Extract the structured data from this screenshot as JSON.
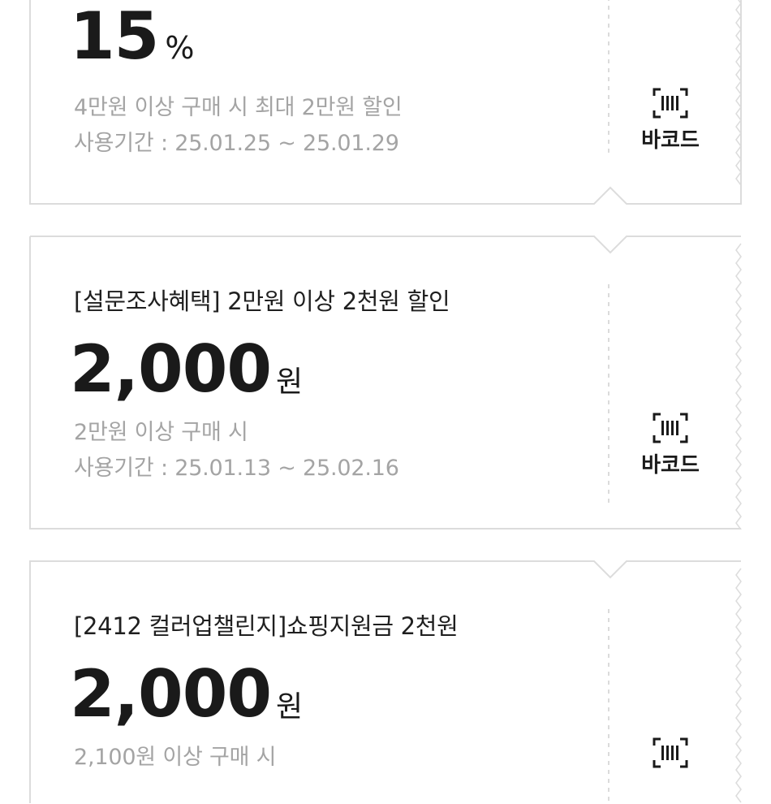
{
  "coupons": [
    {
      "title": "",
      "amount": "15",
      "unit": "%",
      "condition": "4만원 이상 구매 시 최대 2만원 할인",
      "period": "사용기간 : 25.01.25 ~ 25.01.29",
      "barcode_label": "바코드"
    },
    {
      "title": "[설문조사혜택] 2만원 이상 2천원 할인",
      "amount": "2,000",
      "unit": "원",
      "condition": "2만원 이상 구매 시",
      "period": "사용기간 : 25.01.13 ~ 25.02.16",
      "barcode_label": "바코드"
    },
    {
      "title": "[2412 컬러업챌린지]쇼핑지원금 2천원",
      "amount": "2,000",
      "unit": "원",
      "condition": "2,100원 이상 구매 시",
      "period": "",
      "barcode_label": ""
    }
  ],
  "icons": {
    "barcode": "barcode-icon"
  },
  "colors": {
    "border": "#dcdcdc",
    "muted_text": "#a4a4a4",
    "primary_text": "#1a1a1a"
  }
}
